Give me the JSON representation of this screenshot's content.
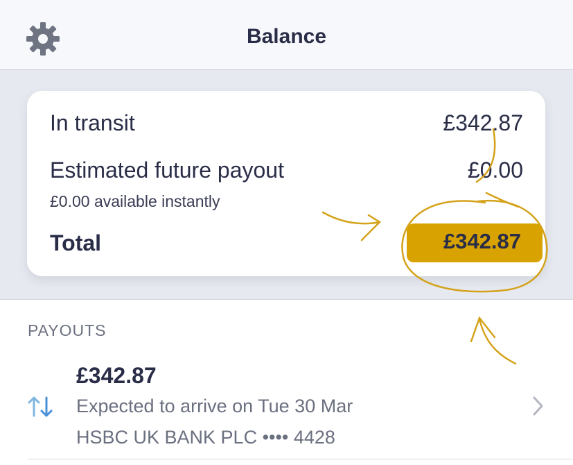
{
  "header": {
    "title": "Balance",
    "settings_icon": "gear-icon"
  },
  "balance_card": {
    "in_transit": {
      "label": "In transit",
      "value": "£342.87"
    },
    "estimated_future_payout": {
      "label": "Estimated future payout",
      "value": "£0.00"
    },
    "available_instantly": "£0.00 available instantly",
    "total": {
      "label": "Total",
      "value": "£342.87"
    }
  },
  "payouts": {
    "section_title": "PAYOUTS",
    "items": [
      {
        "amount": "£342.87",
        "expected": "Expected to arrive on Tue 30 Mar",
        "bank": "HSBC UK BANK PLC •••• 4428",
        "icon": "transfer-arrows-icon",
        "chevron_icon": "chevron-right-icon"
      }
    ]
  },
  "colors": {
    "text_primary": "#2a2d47",
    "text_secondary": "#6b7080",
    "balance_background": "#e7e9f0",
    "highlight": "#d8a300",
    "transfer_up": "#7fb6e0",
    "transfer_down": "#4a90d9"
  }
}
